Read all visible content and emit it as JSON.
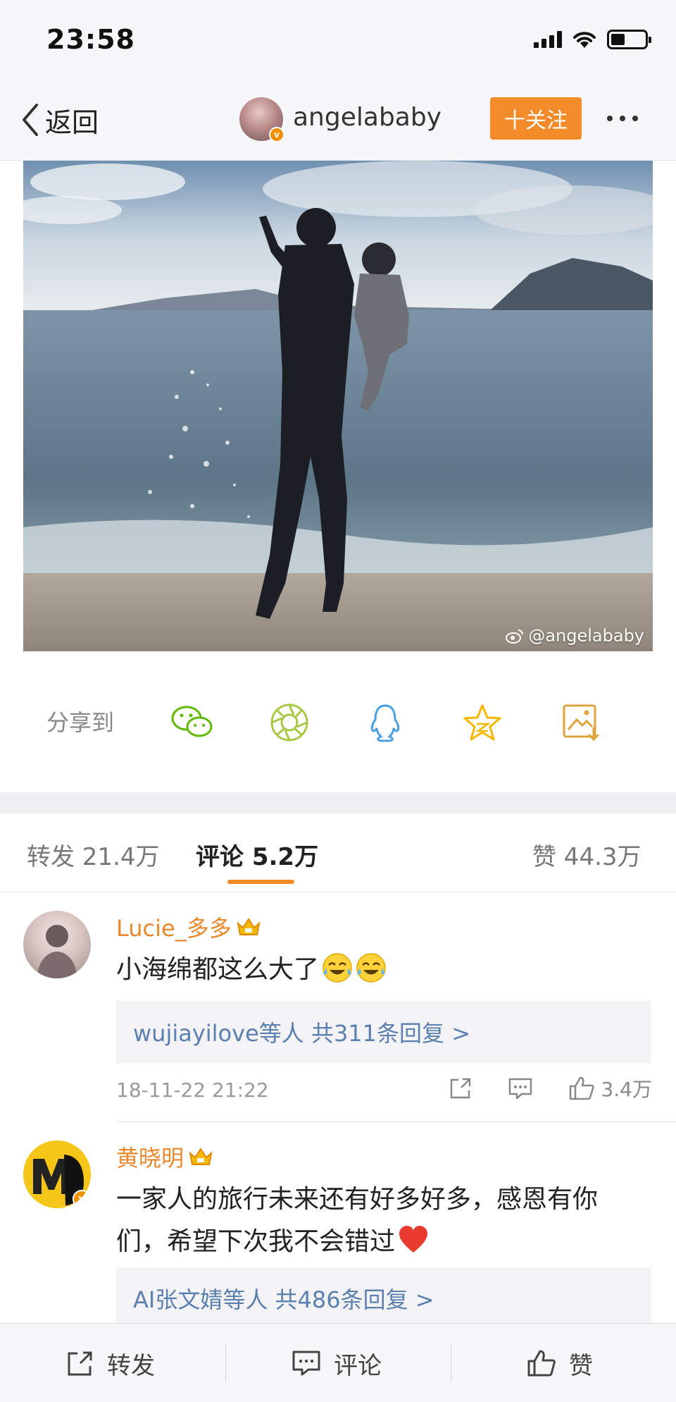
{
  "status_bar": {
    "time": "23:58"
  },
  "nav": {
    "back_label": "返回",
    "username": "angelababy",
    "follow_label": "十关注"
  },
  "photo": {
    "watermark": "@angelababy"
  },
  "share": {
    "label": "分享到",
    "targets": [
      "wechat-icon",
      "moments-icon",
      "qq-icon",
      "qzone-star-icon",
      "save-image-icon"
    ],
    "colors": {
      "wechat": "#62b900",
      "moments": "#a9c848",
      "qq": "#4a9fe3",
      "star": "#f5b800",
      "save": "#e0a23a"
    }
  },
  "tabs": [
    {
      "label": "转发 21.4万"
    },
    {
      "label": "评论 5.2万"
    },
    {
      "label": "赞 44.3万"
    }
  ],
  "comments": [
    {
      "username": "Lucie_多多",
      "text": "小海绵都这么大了",
      "emojis": [
        "crying-laughing-emoji",
        "crying-laughing-emoji"
      ],
      "reply_summary": "wujiayilove等人  共311条回复 >",
      "timestamp": "18-11-22 21:22",
      "likes": "3.4万"
    },
    {
      "username": "黄晓明",
      "text_line1": "一家人的旅行未来还有好多好多，感恩有你",
      "text_line2": "们，希望下次我不会错过",
      "emojis": [
        "red-heart-emoji"
      ],
      "reply_summary": "AI张文婧等人  共486条回复 >"
    }
  ],
  "bottom_bar": {
    "repost_label": "转发",
    "comment_label": "评论",
    "like_label": "赞"
  },
  "colors": {
    "accent": "#f38b2a",
    "username": "#e8882d",
    "link": "#5b7fae"
  }
}
